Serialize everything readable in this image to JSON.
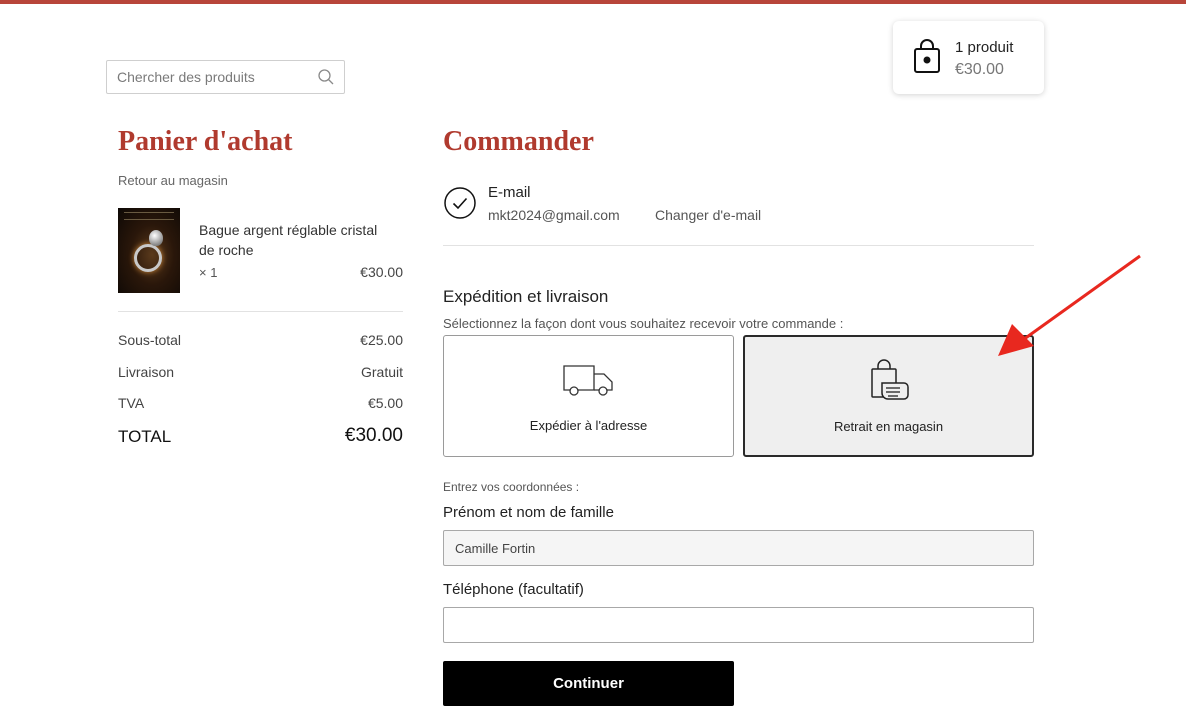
{
  "colors": {
    "accent": "#b03a2e",
    "top_bar": "#b8453a",
    "arrow": "#e8281f",
    "button": "#000000"
  },
  "search": {
    "placeholder": "Chercher des produits",
    "icon": "search-icon"
  },
  "cart_widget": {
    "count_text": "1 produit",
    "total": "€30.00",
    "icon": "shopping-bag-icon"
  },
  "cart": {
    "title": "Panier d'achat",
    "back_link": "Retour au magasin",
    "item": {
      "name": "Bague argent réglable cristal de roche",
      "quantity": "× 1",
      "price": "€30.00"
    },
    "summary": [
      {
        "label": "Sous-total",
        "value": "€25.00"
      },
      {
        "label": "Livraison",
        "value": "Gratuit"
      },
      {
        "label": "TVA",
        "value": "€5.00"
      }
    ],
    "total": {
      "label": "TOTAL",
      "value": "€30.00"
    }
  },
  "checkout": {
    "title": "Commander",
    "email": {
      "label": "E-mail",
      "value": "mkt2024@gmail.com",
      "change_link": "Changer d'e-mail"
    },
    "shipping": {
      "title": "Expédition et livraison",
      "subtitle": "Sélectionnez la façon dont vous souhaitez recevoir votre commande :",
      "options": [
        {
          "label": "Expédier à l'adresse",
          "icon": "truck-icon",
          "selected": false
        },
        {
          "label": "Retrait en magasin",
          "icon": "store-pickup-icon",
          "selected": true
        }
      ]
    },
    "contact": {
      "subtitle": "Entrez vos coordonnées :",
      "name_label": "Prénom et nom de famille",
      "name_value": "Camille Fortin",
      "phone_label": "Téléphone (facultatif)",
      "phone_value": ""
    },
    "continue_label": "Continuer"
  }
}
